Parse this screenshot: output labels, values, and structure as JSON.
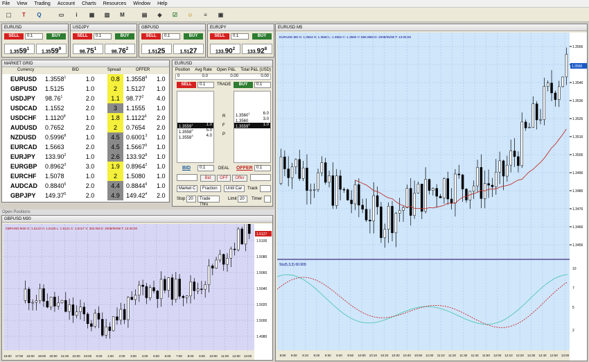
{
  "menu": [
    "File",
    "View",
    "Trading",
    "Account",
    "Charts",
    "Resources",
    "Window",
    "Help"
  ],
  "toolbar_icons": [
    "cursor-icon",
    "new-order-icon",
    "search-icon",
    "rectangle-icon",
    "info-icon",
    "chart-icon",
    "bar-chart-icon",
    "ms-icon",
    "news-icon",
    "layers-icon",
    "checklist-icon",
    "chat-icon",
    "chart-settings-icon",
    "resources-icon"
  ],
  "quotes": [
    {
      "symbol": "EURUSD",
      "sell": "SELL",
      "buy": "BUY",
      "lot": "0.1",
      "bid_main": "1.35",
      "bid_big": "59",
      "bid_sup": "1",
      "ask_main": "1.35",
      "ask_big": "59",
      "ask_sup": "9"
    },
    {
      "symbol": "USDJPY",
      "sell": "SELL",
      "buy": "BUY",
      "lot": "0.1",
      "bid_main": "98.",
      "bid_big": "75",
      "bid_sup": "1",
      "ask_main": "98.",
      "ask_big": "76",
      "ask_sup": "2"
    },
    {
      "symbol": "GBPUSD",
      "sell": "SELL",
      "buy": "BUY",
      "lot": "0.1",
      "bid_main": "1.51",
      "bid_big": "25",
      "bid_sup": "",
      "ask_main": "1.51",
      "ask_big": "27",
      "ask_sup": ""
    },
    {
      "symbol": "EURJPY",
      "sell": "SELL",
      "buy": "BUY",
      "lot": "0.1",
      "bid_main": "133.",
      "bid_big": "90",
      "bid_sup": "2",
      "ask_main": "133.",
      "ask_big": "92",
      "ask_sup": "8"
    }
  ],
  "market_grid": {
    "title": "MARKET GRID",
    "headers": [
      "Currency",
      "BID",
      "Spread",
      "OFFER"
    ],
    "rows": [
      {
        "sym": "EURUSD",
        "bid": "1.3558",
        "bid_sup": "1",
        "lot": "1.0",
        "spread": "0.8",
        "color": "y",
        "offer": "1.3558",
        "offer_sup": "9",
        "lot2": "1.0"
      },
      {
        "sym": "GBPUSD",
        "bid": "1.5125",
        "bid_sup": "",
        "lot": "1.0",
        "spread": "2",
        "color": "y",
        "offer": "1.5127",
        "offer_sup": "",
        "lot2": "1.0"
      },
      {
        "sym": "USDJPY",
        "bid": "98.76",
        "bid_sup": "1",
        "lot": "2.0",
        "spread": "1.1",
        "color": "y",
        "offer": "98.77",
        "offer_sup": "2",
        "lot2": "4.0"
      },
      {
        "sym": "USDCAD",
        "bid": "1.1552",
        "bid_sup": "",
        "lot": "2.0",
        "spread": "3",
        "color": "g",
        "offer": "1.1555",
        "offer_sup": "",
        "lot2": "1.0"
      },
      {
        "sym": "USDCHF",
        "bid": "1.1120",
        "bid_sup": "8",
        "lot": "1.0",
        "spread": "1.8",
        "color": "y",
        "offer": "1.1122",
        "offer_sup": "6",
        "lot2": "2.0"
      },
      {
        "sym": "AUDUSD",
        "bid": "0.7652",
        "bid_sup": "",
        "lot": "2.0",
        "spread": "2",
        "color": "y",
        "offer": "0.7654",
        "offer_sup": "",
        "lot2": "2.0"
      },
      {
        "sym": "NZDUSD",
        "bid": "0.5996",
        "bid_sup": "8",
        "lot": "1.0",
        "spread": "4.5",
        "color": "g",
        "offer": "0.6001",
        "offer_sup": "3",
        "lot2": "1.0"
      },
      {
        "sym": "EURCAD",
        "bid": "1.5663",
        "bid_sup": "",
        "lot": "2.0",
        "spread": "4.5",
        "color": "g",
        "offer": "1.5667",
        "offer_sup": "5",
        "lot2": "1.0"
      },
      {
        "sym": "EURJPY",
        "bid": "133.90",
        "bid_sup": "2",
        "lot": "1.0",
        "spread": "2.6",
        "color": "g",
        "offer": "133.92",
        "offer_sup": "8",
        "lot2": "1.0"
      },
      {
        "sym": "EURGBP",
        "bid": "0.8962",
        "bid_sup": "3",
        "lot": "3.0",
        "spread": "1.9",
        "color": "y",
        "offer": "0.8964",
        "offer_sup": "2",
        "lot2": "1.0"
      },
      {
        "sym": "EURCHF",
        "bid": "1.5078",
        "bid_sup": "",
        "lot": "1.0",
        "spread": "2",
        "color": "y",
        "offer": "1.5080",
        "offer_sup": "",
        "lot2": "1.0"
      },
      {
        "sym": "AUDCAD",
        "bid": "0.8840",
        "bid_sup": "5",
        "lot": "2.0",
        "spread": "4.4",
        "color": "g",
        "offer": "0.8844",
        "offer_sup": "9",
        "lot2": "1.0"
      },
      {
        "sym": "GBPJPY",
        "bid": "149.37",
        "bid_sup": "5",
        "lot": "2.0",
        "spread": "4.9",
        "color": "g",
        "offer": "149.42",
        "offer_sup": "4",
        "lot2": "2.0"
      }
    ]
  },
  "trade_panel": {
    "title": "EURUSD",
    "headers": [
      "Position",
      "Avg Rate",
      "Open P&L",
      "Total P&L (USD)"
    ],
    "values": [
      "0",
      "0.0",
      "0.00",
      "0.00"
    ],
    "sell": "SELL",
    "buy": "BUY",
    "trade": "TRADE",
    "lot": "0.1",
    "bids": [
      [
        "1.3559",
        "1",
        "1.0"
      ],
      [
        "1.3558",
        "9",
        "5.0"
      ],
      [
        "1.3558",
        "3",
        "4.0"
      ]
    ],
    "asks": [
      [
        "1.3560",
        "1",
        "6.0"
      ],
      [
        "1.3560",
        "",
        "3.0"
      ],
      [
        "1.3559",
        "9",
        "1.0"
      ]
    ],
    "rfp": [
      "R",
      "F",
      "P"
    ],
    "bid_label": "BID",
    "deal_label": "DEAL",
    "offer_label": "OFFER",
    "bid_btn": "Bid",
    "off_btn": "OFF",
    "offer_btn": "Offer",
    "market": "Market C",
    "fraction": "Fraction",
    "until": "Until Car",
    "track": "Track",
    "stop": "Stop",
    "stop_val": "20",
    "trade_thru": "Trade Thru",
    "limit": "Limit",
    "limit_val": "20",
    "timer": "Timer"
  },
  "open_positions_label": "Open Positions",
  "eurusd_chart": {
    "title": "EURUSD M5",
    "info": "EURUSD M5 O: 1.3553 H: 1.3560 L: 1.3552 C: 1.3560 V: 586.99M D: 2009/05/08 T: 13:05:00",
    "price_tag": "1.3560",
    "price_axis": [
      "1.3566",
      "1.3556",
      "1.3546",
      "1.3536",
      "1.3526",
      "1.3516",
      "1.3506",
      "1.3496",
      "1.3486",
      "1.3476",
      "1.3466",
      "1.3456"
    ],
    "time_axis": [
      "8:50",
      "9:00",
      "9:10",
      "9:20",
      "9:30",
      "9:40",
      "9:50",
      "10:00",
      "10:10",
      "10:20",
      "10:30",
      "10:40",
      "10:50",
      "11:00",
      "11:10",
      "11:20",
      "11:30",
      "11:40",
      "11:50",
      "12:00",
      "12:10",
      "12:20",
      "12:30",
      "12:40",
      "12:50",
      "13:00"
    ],
    "stoch_label": "Sto(5,3,3)  60.909",
    "stoch_axis": [
      "10",
      "7",
      "5",
      "2"
    ]
  },
  "gbpusd_chart": {
    "title": "GBPUSD M30",
    "info": "GBPUSD M30 O: 1.5122 H: 1.5126 L: 1.5121 C: 1.5127 V: 302.0M D: 2009/05/08 T: 13:30:00",
    "price_tag": "1.5127",
    "price_axis": [
      "1.5100",
      "1.5080",
      "1.5060",
      "1.5040",
      "1.5020",
      "1.5000",
      "1.4980"
    ],
    "time_axis": [
      "16:00",
      "17:00",
      "18:00",
      "19:00",
      "20:00",
      "21:00",
      "22:00",
      "23:00",
      "0:00",
      "1:00",
      "2:00",
      "3:00",
      "4:00",
      "5:00",
      "6:00",
      "7:00",
      "8:00",
      "9:00",
      "10:00",
      "11:00",
      "12:00",
      "13:00"
    ]
  },
  "colors": {
    "sell": "#d62020",
    "buy": "#2e7d32",
    "spread_yellow": "#f4f03c",
    "chart_bg": "#cfe6fb",
    "ma_line": "#c0302a"
  }
}
